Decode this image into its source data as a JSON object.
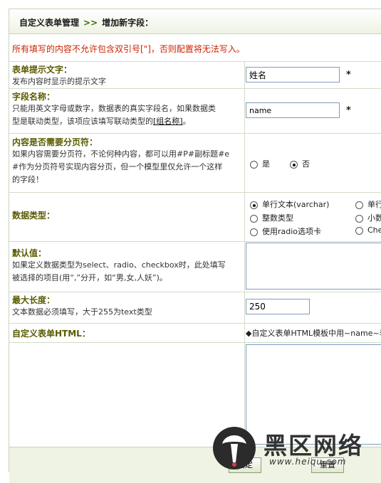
{
  "header": {
    "breadcrumb_1": "自定义表单管理",
    "separator": ">>",
    "breadcrumb_2": "增加新字段："
  },
  "warning": "所有填写的内容不允许包含双引号[\"]，否则配置将无法写入。",
  "fields": {
    "prompt": {
      "title": "表单提示文字：",
      "desc": "发布内容时显示的提示文字",
      "value": "姓名",
      "required_mark": "*"
    },
    "name": {
      "title": "字段名称：",
      "desc_1": "只能用英文字母或数字，数据表的真实字段名，如果数据类",
      "desc_2a": "型是联动类型，该项应该填写联动类型的",
      "desc_link": "[组名称]",
      "desc_2b": "。",
      "value": "name",
      "required_mark": "*"
    },
    "paging": {
      "title": "内容是否需要分页符：",
      "desc_1": "如果内容需要分页符，不论何种内容，都可以用#P#副标题#e",
      "desc_2": "#作为分页符号实现内容分页，但一个模型里仅允许一个这样",
      "desc_3": "的字段！",
      "opt_yes": "是",
      "opt_no": "否",
      "selected": "否"
    },
    "datatype": {
      "title": "数据类型：",
      "options": [
        "单行文本(varchar)",
        "单行",
        "整数类型",
        "小数",
        "使用radio选项卡",
        "Chec"
      ],
      "selected": "单行文本(varchar)"
    },
    "default": {
      "title": "默认值：",
      "desc_1": "如果定义数据类型为select、radio、checkbox时，此处填写",
      "desc_2": "被选择的项目(用“,”分开，如“男,女,人妖”)。",
      "value": ""
    },
    "maxlen": {
      "title": "最大长度：",
      "desc": "文本数据必须填写，大于255为text类型",
      "value": "250"
    },
    "html": {
      "title": "自定义表单HTML：",
      "hint": "◆自定义表单HTML模板中用~name~表",
      "value": ""
    }
  },
  "buttons": {
    "submit": "确定",
    "reset": "重置"
  },
  "watermark": {
    "text_cn": "黑区网络",
    "text_url": "www.heiqu.com"
  }
}
